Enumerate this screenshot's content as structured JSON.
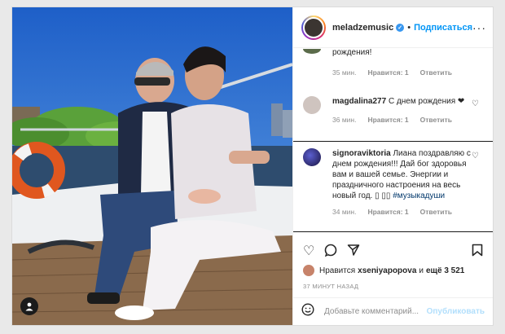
{
  "header": {
    "username": "meladzemusic",
    "follow_label": "Подписаться",
    "more_label": "···"
  },
  "comments": [
    {
      "username": "",
      "text": "рождения!",
      "time": "35 мин.",
      "likes": "Нравится: 1",
      "reply": "Ответить"
    },
    {
      "username": "magdalina277",
      "text": "С днем рождения ❤",
      "time": "36 мин.",
      "likes": "Нравится: 1",
      "reply": "Ответить"
    },
    {
      "username": "signoraviktoria",
      "text": "Лиана поздравляю с днем рождения!!! Дай бог здоровья вам и вашей семье. Энергии и праздничного настроения на весь новый год. ▯ ▯▯ ",
      "hashtag": "#музыкадуши",
      "time": "34 мин.",
      "likes": "Нравится: 1",
      "reply": "Ответить"
    }
  ],
  "likes": {
    "prefix": "Нравится",
    "user": "xseniyapopova",
    "and": "и",
    "count": "ещё 3 521"
  },
  "posted": "37 МИНУТ НАЗАД",
  "add_comment": {
    "placeholder": "Добавьте комментарий...",
    "publish": "Опубликовать"
  },
  "colors": {
    "accent": "#0095f6",
    "text": "#262626",
    "muted": "#8e8e8e"
  },
  "icons": [
    "heart-icon",
    "comment-icon",
    "share-icon",
    "bookmark-icon",
    "emoji-icon",
    "verified-badge-icon",
    "user-tag-icon"
  ]
}
